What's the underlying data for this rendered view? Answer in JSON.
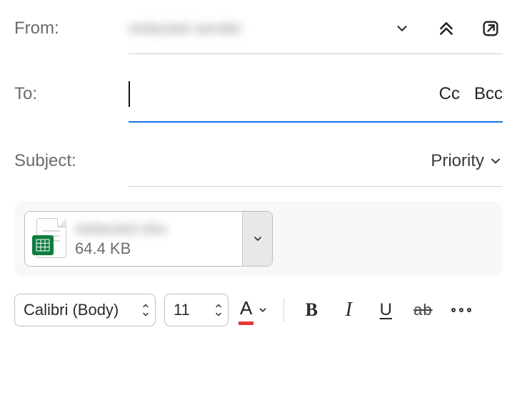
{
  "from": {
    "label": "From:",
    "value": "redacted sender"
  },
  "to": {
    "label": "To:",
    "cc": "Cc",
    "bcc": "Bcc"
  },
  "subject": {
    "label": "Subject:",
    "priority": "Priority"
  },
  "attachment": {
    "name": "redacted.xlsx",
    "size": "64.4 KB"
  },
  "toolbar": {
    "font": "Calibri (Body)",
    "size": "11",
    "bold": "B",
    "italic": "I",
    "underline": "U",
    "strike": "ab"
  }
}
